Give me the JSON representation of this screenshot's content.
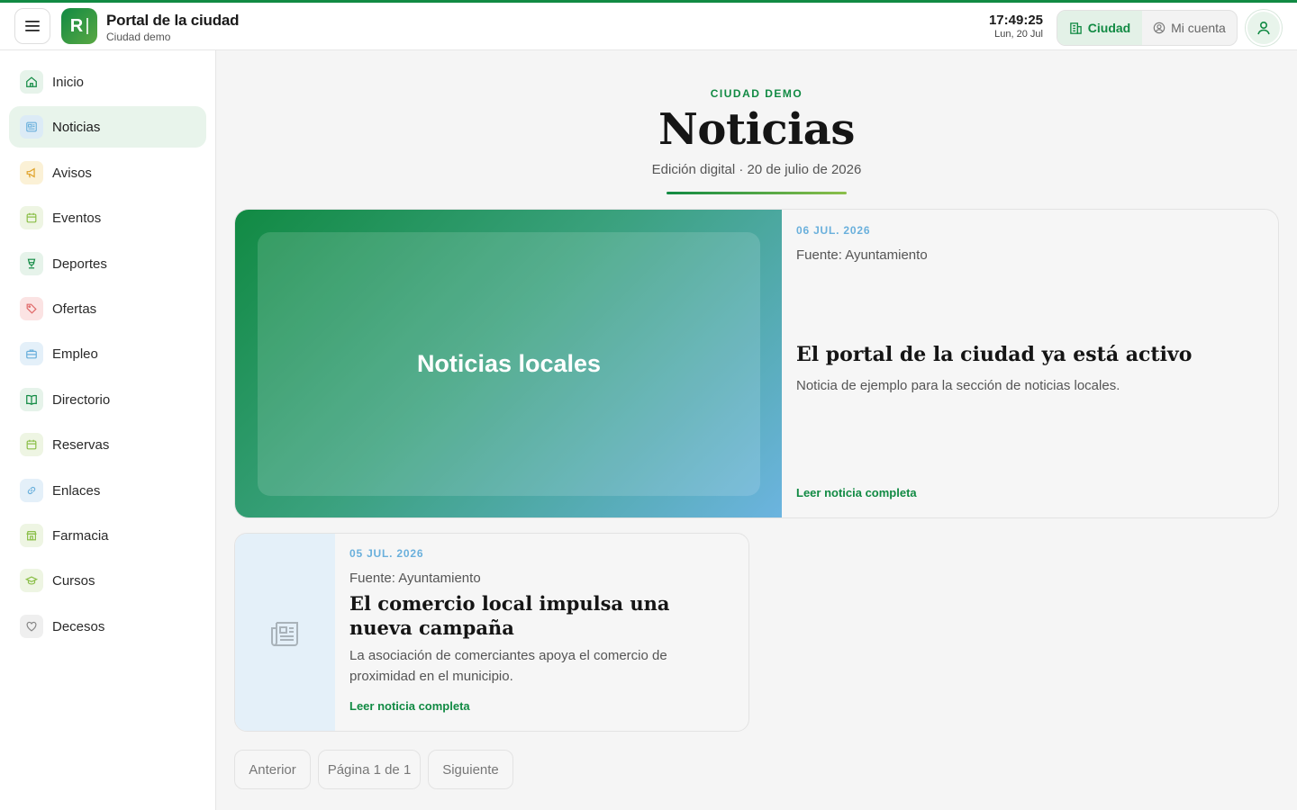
{
  "header": {
    "title": "Portal de la ciudad",
    "subtitle": "Ciudad demo",
    "logo_letter": "R",
    "time": "17:49:25",
    "date": "Lun, 20 Jul",
    "tabs": [
      {
        "label": "Ciudad",
        "icon": "building-icon",
        "active": true
      },
      {
        "label": "Mi cuenta",
        "icon": "user-circle-icon",
        "active": false
      }
    ]
  },
  "sidebar": {
    "items": [
      {
        "label": "Inicio",
        "icon": "home-icon",
        "active": false,
        "color": "#118a43"
      },
      {
        "label": "Noticias",
        "icon": "newspaper-icon",
        "active": true,
        "color": "#6ab0dc"
      },
      {
        "label": "Avisos",
        "icon": "megaphone-icon",
        "active": false,
        "color": "#e0a22a"
      },
      {
        "label": "Eventos",
        "icon": "calendar-icon",
        "active": false,
        "color": "#8cbf4a"
      },
      {
        "label": "Deportes",
        "icon": "trophy-icon",
        "active": false,
        "color": "#118a43"
      },
      {
        "label": "Ofertas",
        "icon": "tag-icon",
        "active": false,
        "color": "#e06a6a"
      },
      {
        "label": "Empleo",
        "icon": "briefcase-icon",
        "active": false,
        "color": "#6ab0dc"
      },
      {
        "label": "Directorio",
        "icon": "book-icon",
        "active": false,
        "color": "#118a43"
      },
      {
        "label": "Reservas",
        "icon": "calendar-icon",
        "active": false,
        "color": "#8cbf4a"
      },
      {
        "label": "Enlaces",
        "icon": "link-icon",
        "active": false,
        "color": "#6ab0dc"
      },
      {
        "label": "Farmacia",
        "icon": "store-icon",
        "active": false,
        "color": "#8cbf4a"
      },
      {
        "label": "Cursos",
        "icon": "graduation-cap-icon",
        "active": false,
        "color": "#8cbf4a"
      },
      {
        "label": "Decesos",
        "icon": "heart-icon",
        "active": false,
        "color": "#888888"
      }
    ]
  },
  "main": {
    "kicker": "CIUDAD DEMO",
    "title": "Noticias",
    "edition": "Edición digital · 20 de julio de 2026",
    "featured": {
      "image_label": "Noticias locales",
      "date": "06 JUL. 2026",
      "source": "Fuente: Ayuntamiento",
      "title": "El portal de la ciudad ya está activo",
      "description": "Noticia de ejemplo para la sección de noticias locales.",
      "link": "Leer noticia completa"
    },
    "articles": [
      {
        "date": "05 JUL. 2026",
        "source": "Fuente: Ayuntamiento",
        "title": "El comercio local impulsa una nueva campaña",
        "description": "La asociación de comerciantes apoya el comercio de proximidad en el municipio.",
        "link": "Leer noticia completa",
        "thumb_icon": "newspaper-icon"
      }
    ],
    "pagination": {
      "prev": "Anterior",
      "page": "Página 1 de 1",
      "next": "Siguiente"
    }
  },
  "colors": {
    "accent": "#118a43",
    "accent_light": "#e8f4eb",
    "date_blue": "#6ab0dc"
  }
}
